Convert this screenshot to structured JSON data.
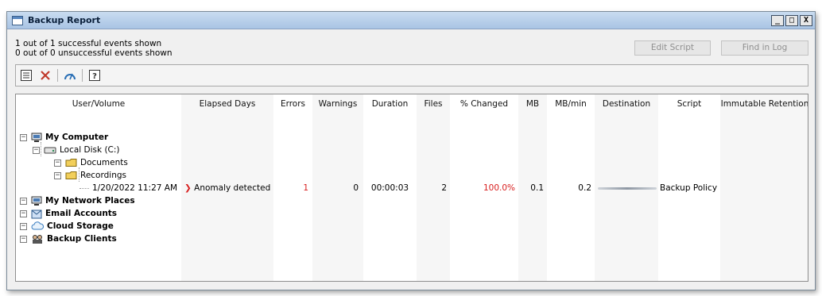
{
  "window": {
    "title": "Backup Report"
  },
  "summary": {
    "successful": "1 out of 1 successful events shown",
    "unsuccessful": "0 out of 0 unsuccessful events shown"
  },
  "buttons": {
    "edit_script": "Edit Script",
    "find_in_log": "Find in Log"
  },
  "window_controls": {
    "minimize": "_",
    "maximize": "□",
    "close": "X"
  },
  "columns": [
    "User/Volume",
    "Elapsed Days",
    "Errors",
    "Warnings",
    "Duration",
    "Files",
    "% Changed",
    "MB",
    "MB/min",
    "Destination",
    "Script",
    "Immutable Retention"
  ],
  "tree": {
    "my_computer": "My Computer",
    "local_disk": "Local Disk (C:)",
    "documents": "Documents",
    "recordings": "Recordings",
    "event_time": "1/20/2022 11:27 AM",
    "my_network_places": "My Network Places",
    "email_accounts": "Email Accounts",
    "cloud_storage": "Cloud Storage",
    "backup_clients": "Backup Clients"
  },
  "row": {
    "elapsed_days": "Anomaly detected",
    "errors": "1",
    "warnings": "0",
    "duration": "00:00:03",
    "files": "2",
    "changed": "100.0%",
    "mb": "0.1",
    "mb_min": "0.2",
    "script": "Backup Policy"
  },
  "colors": {
    "error": "#d81e1e",
    "titlebar": "#a9c4e4",
    "folder": "#f2cf5a"
  },
  "icons": [
    "list-icon",
    "delete-icon",
    "gauge-icon",
    "help-icon",
    "computer-icon",
    "disk-icon",
    "folder-icon",
    "network-icon",
    "email-icon",
    "cloud-icon",
    "clients-icon",
    "chevron-right-icon"
  ]
}
